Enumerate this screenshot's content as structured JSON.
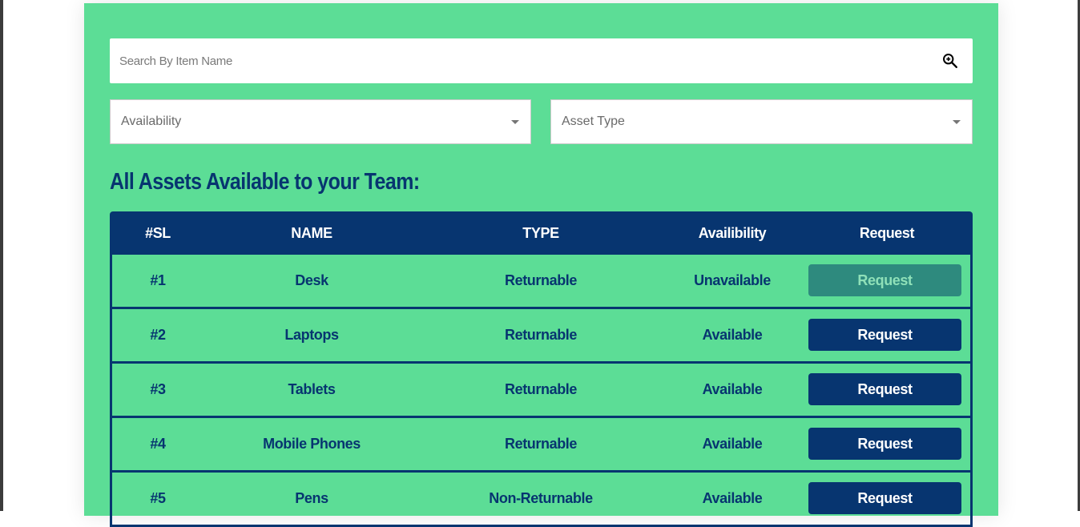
{
  "search": {
    "placeholder": "Search By Item Name",
    "icon": "zoom-in-icon"
  },
  "filters": {
    "availability_label": "Availability",
    "asset_type_label": "Asset Type"
  },
  "section_title": "All Assets Available to your Team:",
  "table": {
    "headers": {
      "sl": "#SL",
      "name": "NAME",
      "type": "TYPE",
      "availability": "Availibility",
      "request": "Request"
    },
    "rows": [
      {
        "sl": "#1",
        "name": "Desk",
        "type": "Returnable",
        "availability": "Unavailable",
        "request_label": "Request",
        "request_enabled": false
      },
      {
        "sl": "#2",
        "name": "Laptops",
        "type": "Returnable",
        "availability": "Available",
        "request_label": "Request",
        "request_enabled": true
      },
      {
        "sl": "#3",
        "name": "Tablets",
        "type": "Returnable",
        "availability": "Available",
        "request_label": "Request",
        "request_enabled": true
      },
      {
        "sl": "#4",
        "name": "Mobile Phones",
        "type": "Returnable",
        "availability": "Available",
        "request_label": "Request",
        "request_enabled": true
      },
      {
        "sl": "#5",
        "name": "Pens",
        "type": "Non-Returnable",
        "availability": "Available",
        "request_label": "Request",
        "request_enabled": true
      }
    ]
  },
  "colors": {
    "panel_background": "#5cdd96",
    "primary": "#073570",
    "disabled_button": "#2e8a7e",
    "disabled_button_text": "#8fe0b8"
  }
}
